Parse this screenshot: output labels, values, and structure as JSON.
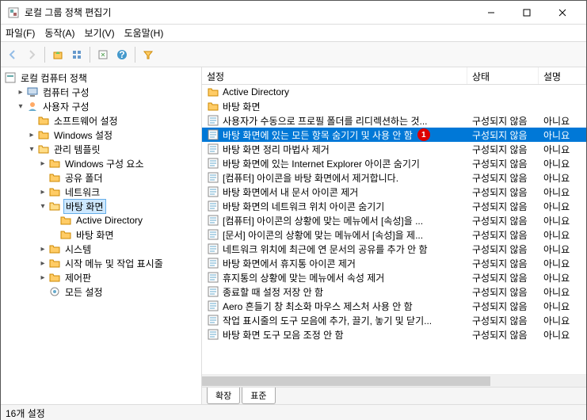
{
  "window": {
    "title": "로컬 그룹 정책 편집기"
  },
  "menu": {
    "file": "파일(F)",
    "action": "동작(A)",
    "view": "보기(V)",
    "help": "도움말(H)"
  },
  "tree": {
    "root": "로컬 컴퓨터 정책",
    "computer": "컴퓨터 구성",
    "user": "사용자 구성",
    "soft": "소프트웨어 설정",
    "win": "Windows 설정",
    "adm": "관리 템플릿",
    "winc": "Windows 구성 요소",
    "shared": "공유 폴더",
    "net": "네트워크",
    "desktop": "바탕 화면",
    "ad": "Active Directory",
    "desktop2": "바탕 화면",
    "system": "시스템",
    "startmenu": "시작 메뉴 및 작업 표시줄",
    "control": "제어판",
    "all": "모든 설정"
  },
  "columns": {
    "name": "설정",
    "state": "상태",
    "desc": "설명"
  },
  "tabs": {
    "extended": "확장",
    "standard": "표준"
  },
  "status": "16개 설정",
  "badge": "1",
  "state_default": "구성되지 않음",
  "desc_default": "아니요",
  "items": [
    {
      "type": "folder",
      "name": "Active Directory"
    },
    {
      "type": "folder",
      "name": "바탕 화면"
    },
    {
      "type": "setting",
      "name": "사용자가 수동으로 프로필 폴더를 리디렉션하는 것...",
      "state": "구성되지 않음",
      "desc": "아니요"
    },
    {
      "type": "setting",
      "name": "바탕 화면에 있는 모든 항목 숨기기 및 사용 안 함",
      "state": "구성되지 않음",
      "desc": "아니요",
      "selected": true,
      "badge": true
    },
    {
      "type": "setting",
      "name": "바탕 화면 정리 마법사 제거",
      "state": "구성되지 않음",
      "desc": "아니요"
    },
    {
      "type": "setting",
      "name": "바탕 화면에 있는 Internet Explorer 아이콘 숨기기",
      "state": "구성되지 않음",
      "desc": "아니요"
    },
    {
      "type": "setting",
      "name": "[컴퓨터] 아이콘을 바탕 화면에서 제거합니다.",
      "state": "구성되지 않음",
      "desc": "아니요"
    },
    {
      "type": "setting",
      "name": "바탕 화면에서 내 문서 아이콘 제거",
      "state": "구성되지 않음",
      "desc": "아니요"
    },
    {
      "type": "setting",
      "name": "바탕 화면의 네트워크 위치 아이콘 숨기기",
      "state": "구성되지 않음",
      "desc": "아니요"
    },
    {
      "type": "setting",
      "name": "[컴퓨터] 아이콘의 상황에 맞는 메뉴에서 [속성]을 ...",
      "state": "구성되지 않음",
      "desc": "아니요"
    },
    {
      "type": "setting",
      "name": "[문서] 아이콘의 상황에 맞는 메뉴에서 [속성]을 제...",
      "state": "구성되지 않음",
      "desc": "아니요"
    },
    {
      "type": "setting",
      "name": "네트워크 위치에 최근에 연 문서의 공유를 추가 안 함",
      "state": "구성되지 않음",
      "desc": "아니요"
    },
    {
      "type": "setting",
      "name": "바탕 화면에서 휴지통 아이콘 제거",
      "state": "구성되지 않음",
      "desc": "아니요"
    },
    {
      "type": "setting",
      "name": "휴지통의 상황에 맞는 메뉴에서 속성 제거",
      "state": "구성되지 않음",
      "desc": "아니요"
    },
    {
      "type": "setting",
      "name": "종료할 때 설정 저장 안 함",
      "state": "구성되지 않음",
      "desc": "아니요"
    },
    {
      "type": "setting",
      "name": "Aero 흔들기 창 최소화 마우스 제스처 사용 안 함",
      "state": "구성되지 않음",
      "desc": "아니요"
    },
    {
      "type": "setting",
      "name": "작업 표시줄의 도구 모음에 추가, 끌기, 놓기 및 닫기...",
      "state": "구성되지 않음",
      "desc": "아니요"
    },
    {
      "type": "setting",
      "name": "바탕 화면 도구 모음 조정 안 함",
      "state": "구성되지 않음",
      "desc": "아니요"
    }
  ]
}
